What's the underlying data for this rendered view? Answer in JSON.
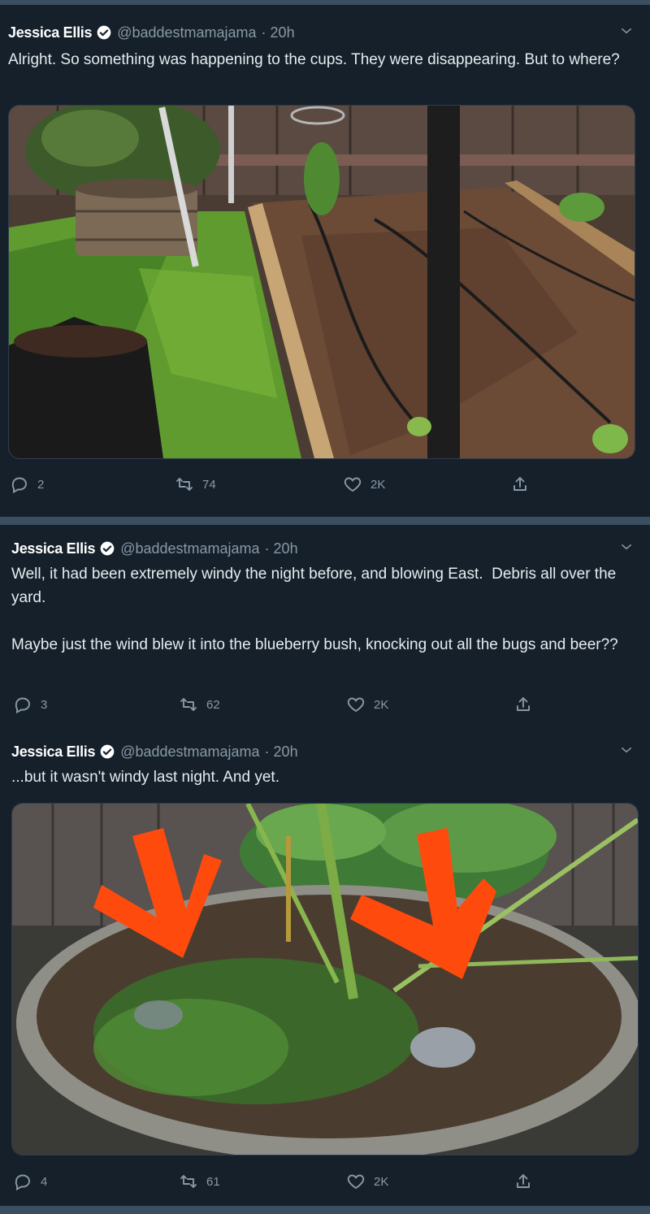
{
  "tweets": [
    {
      "name": "Jessica Ellis",
      "handle": "@baddestmamajama",
      "time": "· 20h",
      "text": "Alright. So something was happening to the cups. They were disappearing. But to where?",
      "image": "garden bed with fence and drip lines",
      "replies": "2",
      "retweets": "74",
      "likes": "2K"
    },
    {
      "name": "Jessica Ellis",
      "handle": "@baddestmamajama",
      "time": "· 20h",
      "text": "Well, it had been extremely windy the night before, and blowing East.  Debris all over the yard.\n\nMaybe just the wind blew it into the blueberry bush, knocking out all the bugs and beer??",
      "replies": "3",
      "retweets": "62",
      "likes": "2K"
    },
    {
      "name": "Jessica Ellis",
      "handle": "@baddestmamajama",
      "time": "· 20h",
      "text": "...but it wasn't windy last night. And yet.",
      "image": "half-barrel planter with two orange arrows",
      "replies": "4",
      "retweets": "61",
      "likes": "2K"
    }
  ],
  "icons": {
    "verified": "verified-badge-icon",
    "chevron": "chevron-down-icon",
    "reply": "reply-icon",
    "retweet": "retweet-icon",
    "like": "heart-icon",
    "share": "share-icon"
  },
  "colors": {
    "background": "#15202b",
    "separator": "#3b4f63",
    "muted": "#8899a6",
    "arrow": "#ff4a0e"
  }
}
